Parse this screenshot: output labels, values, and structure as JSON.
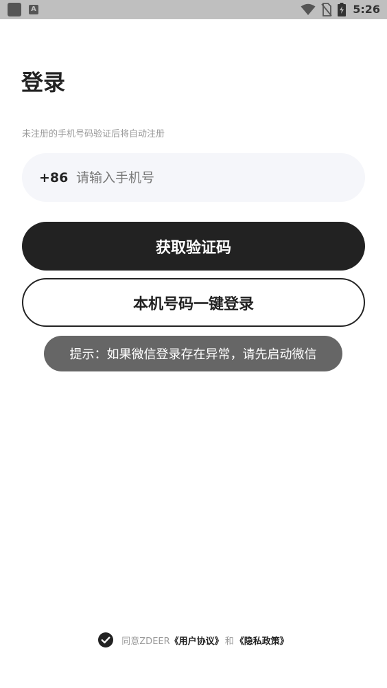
{
  "status_bar": {
    "time": "5:26",
    "left_icons": [
      "app-square-icon",
      "a-notification-icon"
    ],
    "right_icons": [
      "wifi-icon",
      "no-sim-icon",
      "battery-charging-icon"
    ]
  },
  "login": {
    "title": "登录",
    "hint": "未注册的手机号码验证后将自动注册",
    "country_code": "+86",
    "phone_placeholder": "请输入手机号",
    "phone_value": "",
    "get_code_label": "获取验证码",
    "one_key_label": "本机号码一键登录"
  },
  "toast": {
    "text": "提示：如果微信登录存在异常，请先启动微信"
  },
  "agreement": {
    "checked": true,
    "prefix": "同意ZDEER",
    "user_agreement": "《用户协议》",
    "and": "和",
    "privacy_policy": "《隐私政策》"
  },
  "colors": {
    "primary": "#222222",
    "input_bg": "#f5f6fa",
    "toast_bg": "#666666",
    "hint": "#999999",
    "status_bar_bg": "#bfbfbf"
  }
}
